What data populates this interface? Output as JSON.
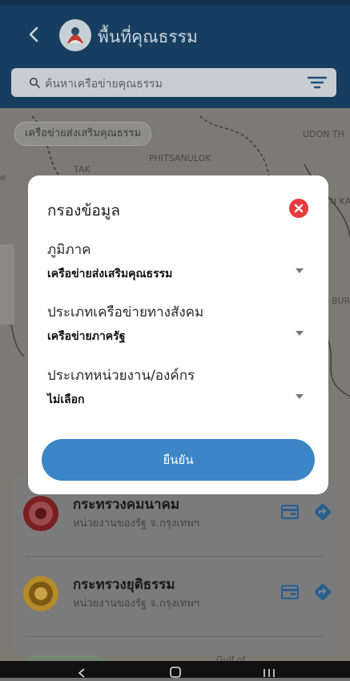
{
  "header": {
    "title": "พื้นที่คุณธรรม",
    "search_placeholder": "ค้นหาเครือข่ายคุณธรรม"
  },
  "map": {
    "chip": "เครือข่ายส่งเสริมคุณธรรม",
    "labels": {
      "tak": "TAK",
      "phitsanulok": "PHITSANULOK",
      "udon": "UDON TH",
      "edge_left": "e",
      "edge_right_ka": "N KA",
      "edge_right_bur": "BUR",
      "gulf": "Gulf of"
    }
  },
  "modal": {
    "title": "กรองข้อมูล",
    "fields": [
      {
        "label": "ภูมิภาค",
        "value": "เครือข่ายส่งเสริมคุณธรรม"
      },
      {
        "label": "ประเภทเครือข่ายทางสังคม",
        "value": "เครือข่ายภาครัฐ"
      },
      {
        "label": "ประเภทหน่วยงาน/องค์กร",
        "value": "ไม่เลือก"
      }
    ],
    "confirm_label": "ยืนยัน"
  },
  "list": [
    {
      "name": "กระทรวงคมนาคม",
      "subtitle": "หน่วยงานของรัฐ จ.กรุงเทพฯ",
      "seal_color": "#7a1f22"
    },
    {
      "name": "กระทรวงยุติธรรม",
      "subtitle": "หน่วยงานของรัฐ จ.กรุงเทพฯ",
      "seal_color": "#b48a2a"
    }
  ],
  "colors": {
    "header": "#173e60",
    "accent": "#3c86c7",
    "close": "#e8393d",
    "icon_blue": "#2a5e92"
  },
  "icons": [
    "back-arrow-icon",
    "logo-icon",
    "search-icon",
    "filter-icon",
    "close-icon",
    "dropdown-caret-icon",
    "card-icon",
    "directions-icon",
    "nav-back-icon",
    "nav-home-icon",
    "nav-recents-icon"
  ]
}
